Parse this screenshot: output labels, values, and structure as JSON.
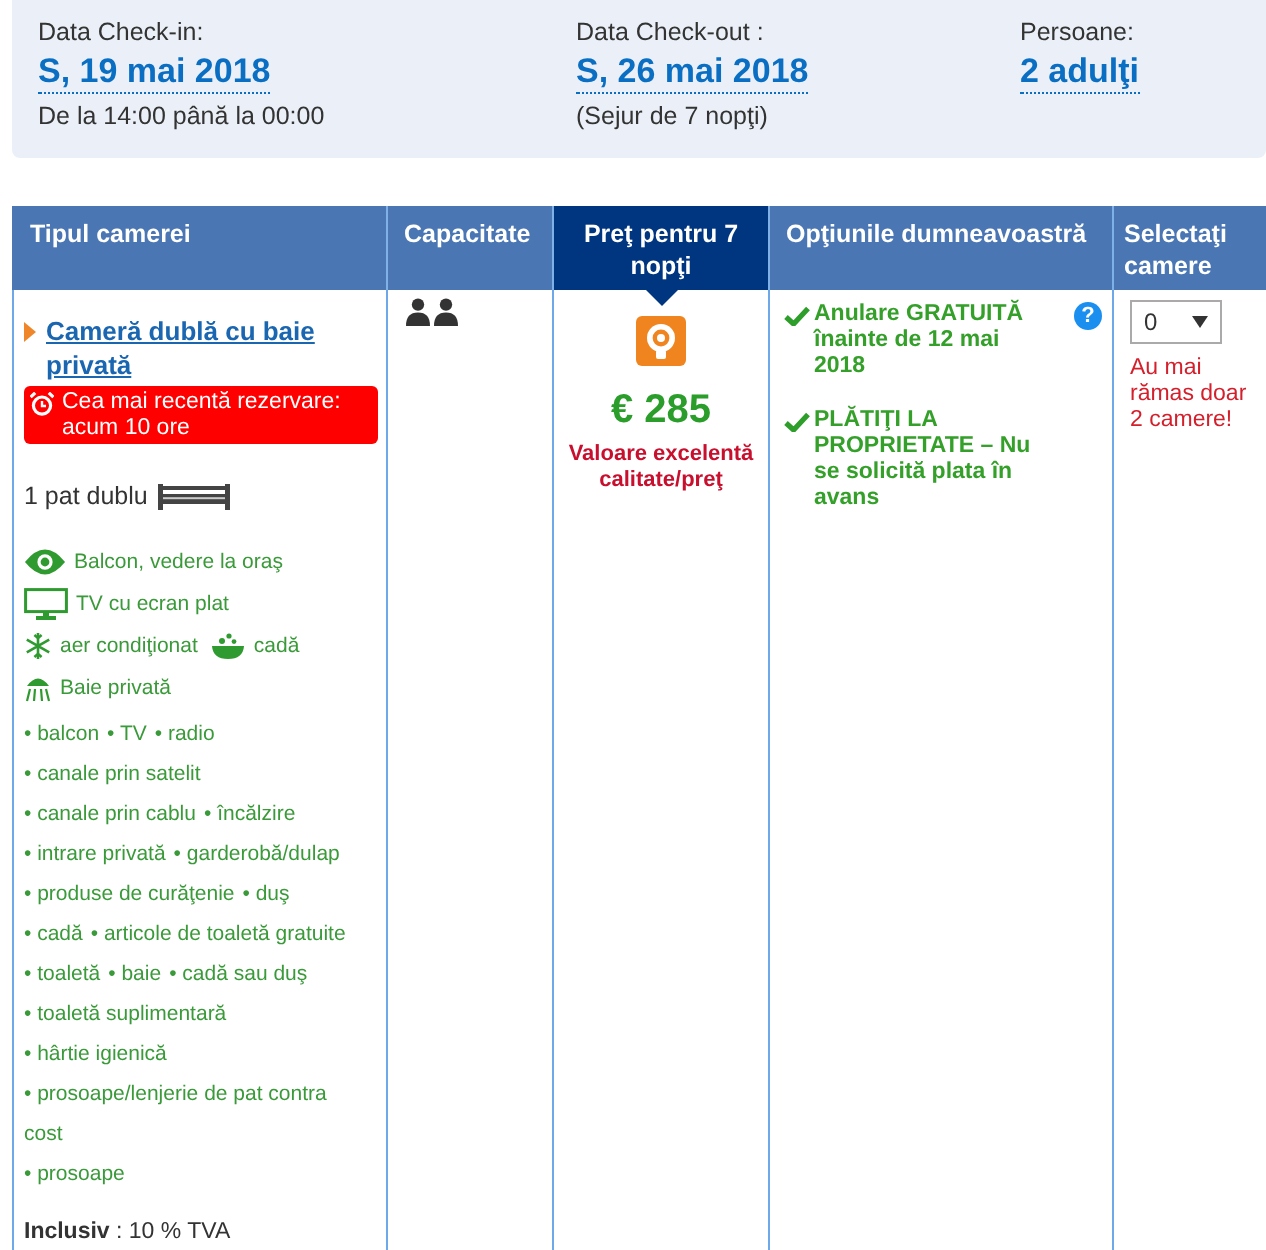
{
  "stay": {
    "checkin": {
      "label": "Data Check-in:",
      "date": "S, 19 mai 2018",
      "note": "De la 14:00 până la 00:00"
    },
    "checkout": {
      "label": "Data Check-out :",
      "date": "S, 26 mai 2018",
      "note": "(Sejur de 7 nopţi)"
    },
    "guests": {
      "label": "Persoane:",
      "value": "2 adulţi"
    }
  },
  "table": {
    "columns": [
      {
        "label": "Tipul camerei",
        "highlighted": false
      },
      {
        "label": "Capacitate",
        "highlighted": false
      },
      {
        "label": "Preţ pentru 7 nopţi",
        "highlighted": true
      },
      {
        "label": "Opţiunile dumneavoastră",
        "highlighted": false
      },
      {
        "label": "Selectaţi camere",
        "highlighted": false
      }
    ],
    "row": {
      "room_name": "Cameră dublă cu baie privată",
      "recent_booking": "Cea mai recentă rezervare: acum 10 ore",
      "bed": "1 pat dublu",
      "highlight_lines": [
        [
          {
            "kind": "view",
            "text": "Balcon, vedere la oraş"
          }
        ],
        [
          {
            "kind": "tv",
            "text": "TV cu ecran plat"
          }
        ],
        [
          {
            "kind": "aircon",
            "text": "aer condiţionat"
          },
          {
            "kind": "bath",
            "text": "cadă"
          }
        ],
        [
          {
            "kind": "shower",
            "text": "Baie privată"
          }
        ]
      ],
      "facility_lines": [
        [
          "• balcon",
          "• TV",
          "• radio"
        ],
        [
          "• canale prin satelit"
        ],
        [
          "• canale prin cablu",
          "• încălzire"
        ],
        [
          "• intrare privată",
          "• garderobă/dulap"
        ],
        [
          "• produse de curăţenie",
          "• duş"
        ],
        [
          "• cadă",
          "• articole de toaletă gratuite"
        ],
        [
          "• toaletă",
          "• baie",
          "• cadă sau duş"
        ],
        [
          "• toaletă suplimentară"
        ],
        [
          "• hârtie igienică"
        ],
        [
          "• prosoape/lenjerie de pat contra cost"
        ],
        [
          "• prosoape"
        ]
      ],
      "vat": "**Inclusiv** : 10 % TVA",
      "price": "€ 285",
      "price_rating": "Valoare excelentă calitate/preţ",
      "options": [
        {
          "text": "Anulare GRATUITĂ înainte de 12 mai 2018",
          "help": "?"
        },
        {
          "text": "PLĂTIŢI LA PROPRIETATE – Nu se solicită plata în avans"
        }
      ],
      "select_value": "0",
      "availability": "Au mai rămas doar 2 camere!"
    }
  }
}
